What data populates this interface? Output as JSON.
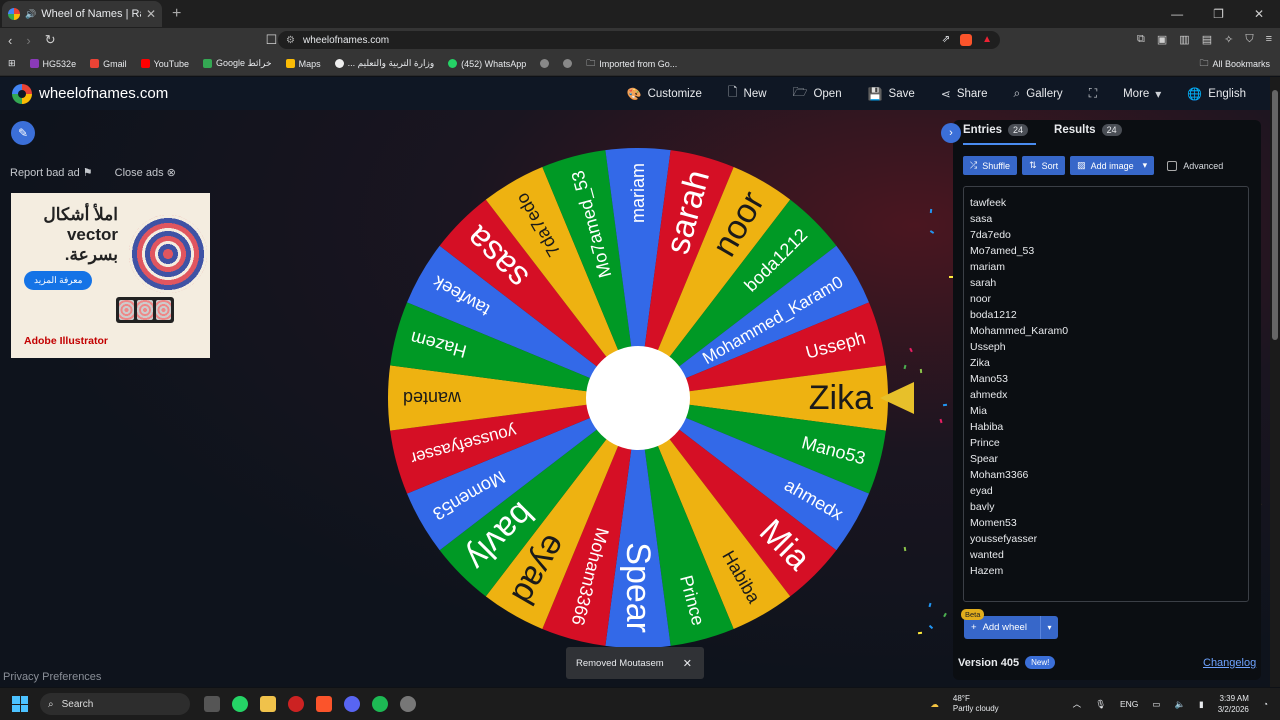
{
  "browser": {
    "tab_title": "Wheel of Names | Random n...",
    "url": "wheelofnames.com",
    "bookmarks": [
      "HG532e",
      "Gmail",
      "YouTube",
      "Google خرائط",
      "Maps",
      "... وزارة التربية والتعليم",
      "(452) WhatsApp",
      "Imported from Go..."
    ],
    "all_bookmarks": "All Bookmarks"
  },
  "site": {
    "logo_text": "wheelofnames.com",
    "menu": [
      "Customize",
      "New",
      "Open",
      "Save",
      "Share",
      "Gallery",
      "More",
      "English"
    ]
  },
  "left": {
    "report_ad": "Report bad ad",
    "close_ads": "Close ads",
    "ad": {
      "headline_line1": "املأ أشكال",
      "headline_line2": "vector",
      "headline_line3": "بسرعة.",
      "cta": "معرفة المزيد",
      "brand": "Adobe Illustrator"
    },
    "privacy": "Privacy Preferences"
  },
  "wheel": {
    "colors": [
      "#3369e8",
      "#d50f25",
      "#eeb211",
      "#009925"
    ],
    "pointer_color": "#e7c02a",
    "selected": "Zika"
  },
  "panel": {
    "tab_entries": "Entries",
    "tab_entries_count": "24",
    "tab_results": "Results",
    "tab_results_count": "24",
    "shuffle": "Shuffle",
    "sort": "Sort",
    "add_image": "Add image",
    "advanced": "Advanced",
    "entries": [
      "tawfeek",
      "sasa",
      "7da7edo",
      "Mo7amed_53",
      "mariam",
      "sarah",
      "noor",
      "boda1212",
      "Mohammed_Karam0",
      "Usseph",
      "Zika",
      "Mano53",
      "ahmedx",
      "Mia",
      "Habiba",
      "Prince",
      "Spear",
      "Moham3366",
      "eyad",
      "bavly",
      "Momen53",
      "youssefyasser",
      "wanted",
      "Hazem"
    ],
    "beta": "Beta",
    "add_wheel": "Add wheel",
    "version": "Version 405",
    "new_badge": "New!",
    "changelog": "Changelog"
  },
  "toast": {
    "text": "Removed Moutasem"
  },
  "taskbar": {
    "search": "Search",
    "temp": "48°F",
    "weather": "Partly cloudy",
    "lang": "ENG",
    "time": "3:39 AM",
    "date": "3/2/2026"
  }
}
